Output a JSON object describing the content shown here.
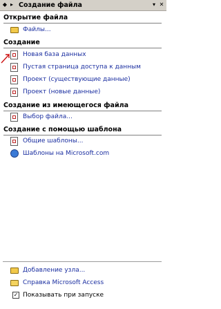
{
  "titlebar": {
    "title": "Создание файла",
    "back_glyph": "◆",
    "forward_glyph": "▸",
    "dropdown_glyph": "▾",
    "close_glyph": "✕"
  },
  "sections": {
    "open_file": {
      "heading": "Открытие файла",
      "items": [
        {
          "label": "Файлы...",
          "icon": "folder-icon"
        }
      ]
    },
    "create": {
      "heading": "Создание",
      "items": [
        {
          "label": "Новая база данных",
          "icon": "new-db-icon"
        },
        {
          "label": "Пустая страница доступа к данным",
          "icon": "page-icon"
        },
        {
          "label": "Проект (существующие данные)",
          "icon": "project-icon"
        },
        {
          "label": "Проект (новые данные)",
          "icon": "project-icon"
        }
      ]
    },
    "from_existing": {
      "heading": "Создание из имеющегося файла",
      "items": [
        {
          "label": "Выбор файла...",
          "icon": "file-icon"
        }
      ]
    },
    "from_template": {
      "heading": "Создание с помощью шаблона",
      "items": [
        {
          "label": "Общие шаблоны...",
          "icon": "templates-icon"
        },
        {
          "label": "Шаблоны на Microsoft.com",
          "icon": "globe-icon"
        }
      ]
    }
  },
  "footer": {
    "add_node": "Добавление узла...",
    "help": "Справка Microsoft Access",
    "show_startup": "Показывать при запуске",
    "show_startup_checked": true,
    "check_glyph": "✓"
  },
  "colors": {
    "link": "#1a2ea0",
    "panel_bg": "#ffffff",
    "titlebar_bg": "#d4d0c8",
    "cursor": "#cc1111"
  }
}
